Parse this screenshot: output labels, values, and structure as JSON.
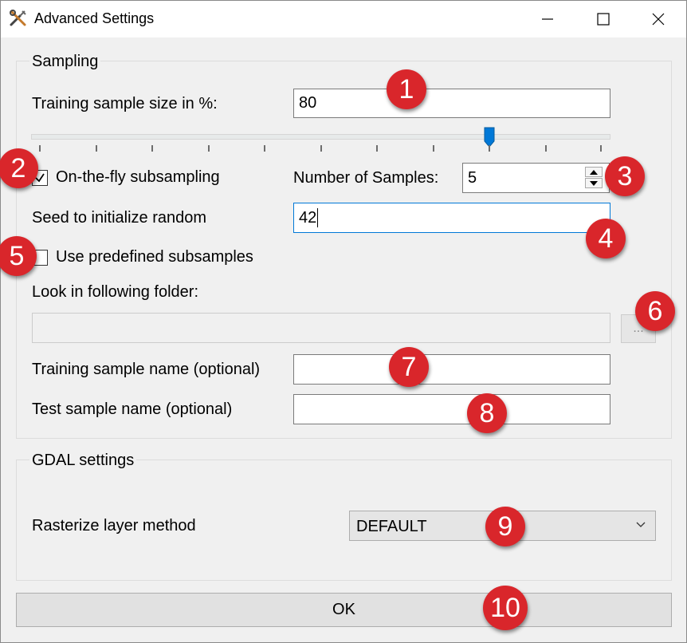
{
  "window": {
    "title": "Advanced Settings",
    "controls": {
      "minimize": "minimize",
      "maximize": "maximize",
      "close": "close"
    }
  },
  "sampling": {
    "group_title": "Sampling",
    "training_size_label": "Training sample size in %:",
    "training_size_value": "80",
    "slider_value_percent": 80,
    "onthefly_label": "On-the-fly subsampling",
    "onthefly_checked": true,
    "num_samples_label": "Number of Samples:",
    "num_samples_value": "5",
    "seed_label": "Seed to initialize random",
    "seed_value": "42",
    "predefined_label": "Use predefined subsamples",
    "predefined_checked": false,
    "folder_label": "Look in following folder:",
    "folder_value": "",
    "browse_label": "...",
    "training_name_label": "Training sample name (optional)",
    "training_name_value": "",
    "test_name_label": "Test sample name (optional)",
    "test_name_value": ""
  },
  "gdal": {
    "group_title": "GDAL settings",
    "rasterize_label": "Rasterize layer method",
    "rasterize_value": "DEFAULT"
  },
  "footer": {
    "ok_label": "OK"
  },
  "annotations": [
    "1",
    "2",
    "3",
    "4",
    "5",
    "6",
    "7",
    "8",
    "9",
    "10"
  ],
  "colors": {
    "badge": "#d9262b",
    "accent": "#0078d7",
    "window_bg": "#f0f0f0"
  }
}
